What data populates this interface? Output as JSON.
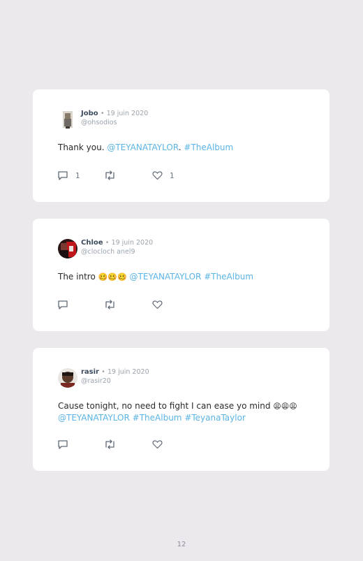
{
  "tweets": [
    {
      "name": "Jobo",
      "date": "19 juin 2020",
      "handle": "@ohsodios",
      "text_parts": [
        "Thank you. ",
        "@TEYANATAYLOR",
        ". ",
        "#TheAlbum"
      ],
      "reply_count": "1",
      "like_count": "1"
    },
    {
      "name": "Chloe",
      "date": "19 juin 2020",
      "handle": "@clocloch anel9",
      "text_parts": [
        "The intro ",
        "🥴🥴🥴",
        " ",
        "@TEYANATAYLOR",
        " ",
        "#TheAlbum"
      ]
    },
    {
      "name": "rasir",
      "date": "19 juin 2020",
      "handle": "@rasir20",
      "text_parts": [
        "Cause tonight, no need to fight I can ease yo mind ",
        "😩😩😩",
        "@TEYANATAYLOR",
        " ",
        "#TheAlbum",
        " ",
        "#TeyanaTaylor"
      ]
    }
  ],
  "separator": "•",
  "page_number": "12",
  "icons": [
    "reply-icon",
    "retweet-icon",
    "like-icon"
  ],
  "colors": {
    "link": "#5ab4e6",
    "background": "#ece8ee",
    "card": "#ffffff"
  }
}
